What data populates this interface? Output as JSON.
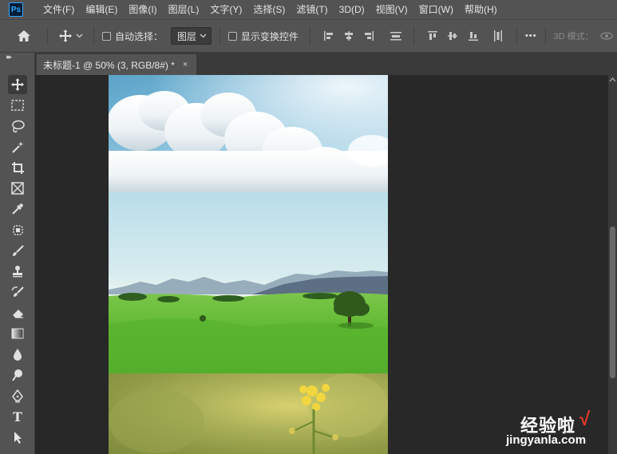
{
  "app": {
    "logo_text": "Ps",
    "brand_color": "#31a8ff"
  },
  "menu": {
    "items": [
      {
        "label": "文件(F)"
      },
      {
        "label": "编辑(E)"
      },
      {
        "label": "图像(I)"
      },
      {
        "label": "图层(L)"
      },
      {
        "label": "文字(Y)"
      },
      {
        "label": "选择(S)"
      },
      {
        "label": "滤镜(T)"
      },
      {
        "label": "3D(D)"
      },
      {
        "label": "视图(V)"
      },
      {
        "label": "窗口(W)"
      },
      {
        "label": "帮助(H)"
      }
    ]
  },
  "options": {
    "home_icon": "home-icon",
    "move_icon": "move-tool-icon",
    "auto_select_label": "自动选择：",
    "auto_select_checked": false,
    "layer_select_value": "图层",
    "show_transform_label": "显示变换控件",
    "show_transform_checked": false,
    "more_label": "•••",
    "mode_3d_label": "3D 模式："
  },
  "document": {
    "tab_title": "未标题-1 @ 50% (3, RGB/8#) *",
    "close_label": "×"
  },
  "toolbox": {
    "tools": [
      {
        "name": "move-tool-icon"
      },
      {
        "name": "rectangular-marquee-icon"
      },
      {
        "name": "lasso-icon"
      },
      {
        "name": "magic-wand-icon"
      },
      {
        "name": "crop-icon"
      },
      {
        "name": "frame-icon"
      },
      {
        "name": "eyedropper-icon"
      },
      {
        "name": "spot-healing-icon"
      },
      {
        "name": "brush-icon"
      },
      {
        "name": "clone-stamp-icon"
      },
      {
        "name": "history-brush-icon"
      },
      {
        "name": "eraser-icon"
      },
      {
        "name": "gradient-icon"
      },
      {
        "name": "blur-icon"
      },
      {
        "name": "dodge-icon"
      },
      {
        "name": "pen-icon"
      },
      {
        "name": "type-tool-icon",
        "label": "T"
      },
      {
        "name": "path-selection-icon"
      }
    ]
  },
  "watermark": {
    "title": "经验啦",
    "check": "√",
    "url": "jingyanla.com"
  }
}
